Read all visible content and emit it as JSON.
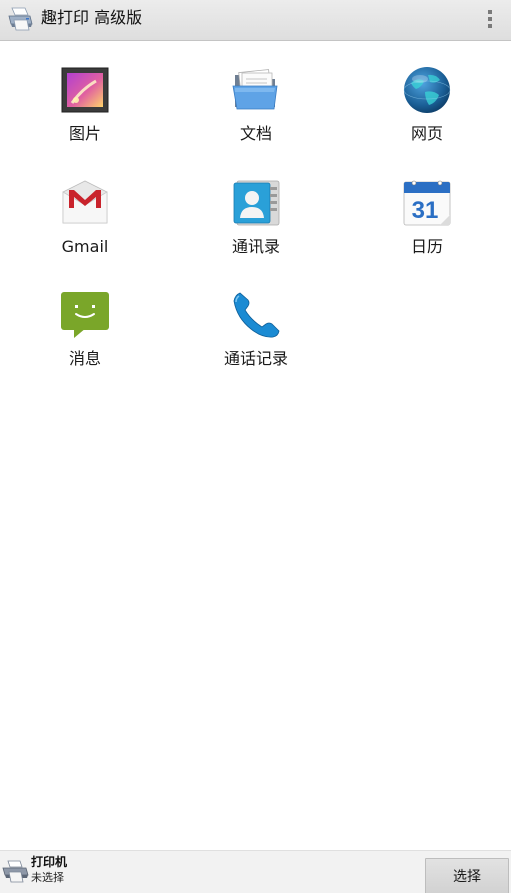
{
  "app_bar": {
    "title": "趣打印 高级版",
    "logo_icon": "printer-logo-icon",
    "overflow_icon": "overflow-menu-icon"
  },
  "tiles": [
    {
      "label": "图片",
      "icon": "photo-gallery-icon"
    },
    {
      "label": "文档",
      "icon": "documents-folder-icon"
    },
    {
      "label": "网页",
      "icon": "globe-icon"
    },
    {
      "label": "Gmail",
      "icon": "gmail-icon"
    },
    {
      "label": "通讯录",
      "icon": "contacts-icon"
    },
    {
      "label": "日历",
      "icon": "calendar-icon",
      "calendar_day": "31"
    },
    {
      "label": "消息",
      "icon": "message-icon"
    },
    {
      "label": "通话记录",
      "icon": "phone-icon"
    }
  ],
  "bottom_bar": {
    "printer_label": "打印机",
    "printer_status": "未选择",
    "select_button_label": "选择",
    "printer_icon": "printer-icon"
  },
  "colors": {
    "app_bar_bg": "#e3e3e3",
    "bottom_bar_bg": "#f2f2f2",
    "button_bg": "#d8d8d8",
    "gmail_red": "#c9232c",
    "calendar_blue": "#2b6fc4",
    "message_green": "#7aa629",
    "phone_blue": "#1b8bd3"
  }
}
